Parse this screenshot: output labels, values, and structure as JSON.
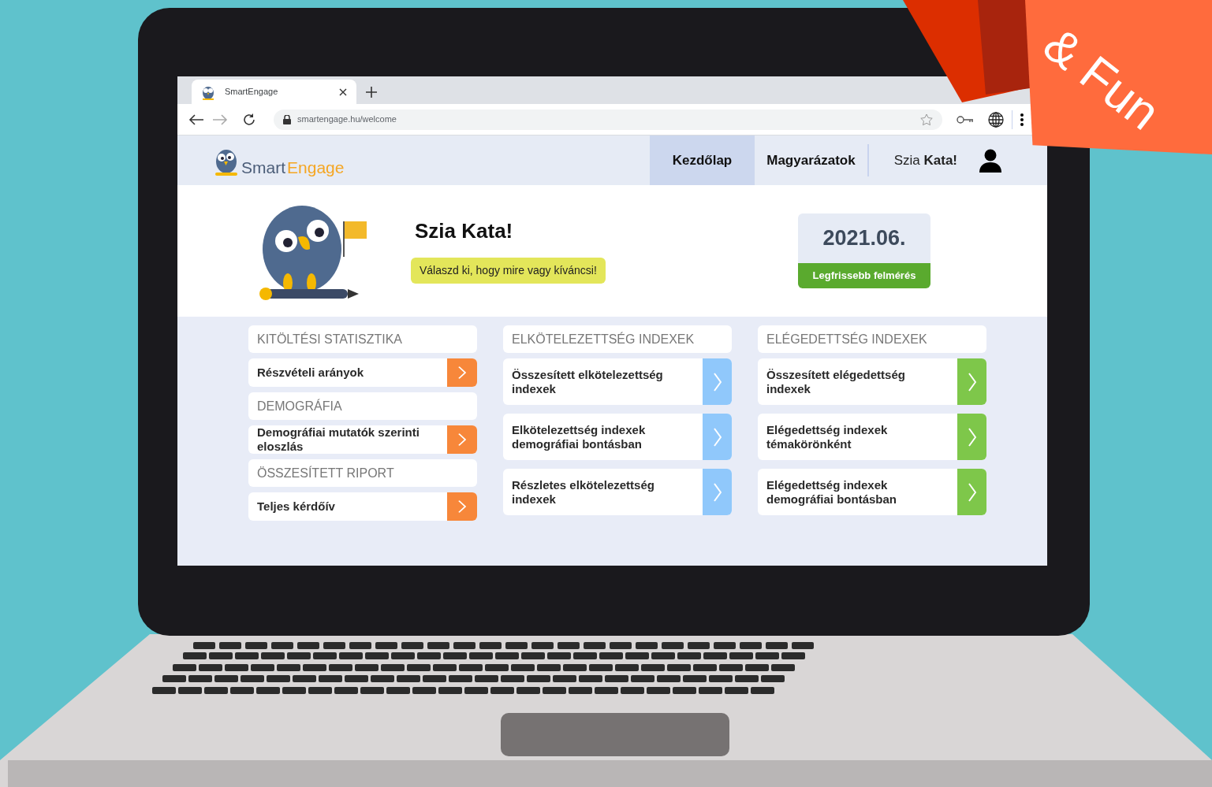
{
  "browser": {
    "tab_title": "SmartEngage",
    "url": "smartengage.hu/welcome"
  },
  "header": {
    "logo": {
      "first": "Smart",
      "second": "Engage"
    },
    "nav": [
      {
        "label": "Kezdőlap",
        "selected": true
      },
      {
        "label": "Magyarázatok",
        "selected": false
      }
    ],
    "greeting": "Szia **Kata!**"
  },
  "hero": {
    "title": "Szia Kata!",
    "bubble": "Válaszd ki, hogy mire vagy kíváncsi!",
    "survey": {
      "date": "2021.06.",
      "button": "Legfrissebb felmérés"
    }
  },
  "columns": [
    {
      "color": "#f7873a",
      "kind": "compact",
      "sections": [
        {
          "heading": "KITÖLTÉSI STATISZTIKA",
          "items": [
            "Részvételi arányok"
          ]
        },
        {
          "heading": "DEMOGRÁFIA",
          "items": [
            "Demográfiai mutatók szerinti eloszlás"
          ]
        },
        {
          "heading": "ÖSSZESÍTETT RIPORT",
          "items": [
            "Teljes kérdőív"
          ]
        }
      ]
    },
    {
      "color": "#90c8fb",
      "kind": "tall",
      "sections": [
        {
          "heading": "ELKÖTELEZETTSÉG INDEXEK",
          "items": [
            "Összesített elkötelezettség indexek",
            "Elkötelezettség indexek demográfiai bontásban",
            "Részletes elkötelezettség indexek"
          ]
        }
      ]
    },
    {
      "color": "#7ec74a",
      "kind": "tall",
      "sections": [
        {
          "heading": "ELÉGEDETTSÉG INDEXEK",
          "items": [
            "Összesített elégedettség indexek",
            "Elégedettség indexek témakörönként",
            "Elégedettség indexek demográfiai bontásban"
          ]
        }
      ]
    }
  ],
  "ribbon": {
    "text": "& Fun"
  }
}
